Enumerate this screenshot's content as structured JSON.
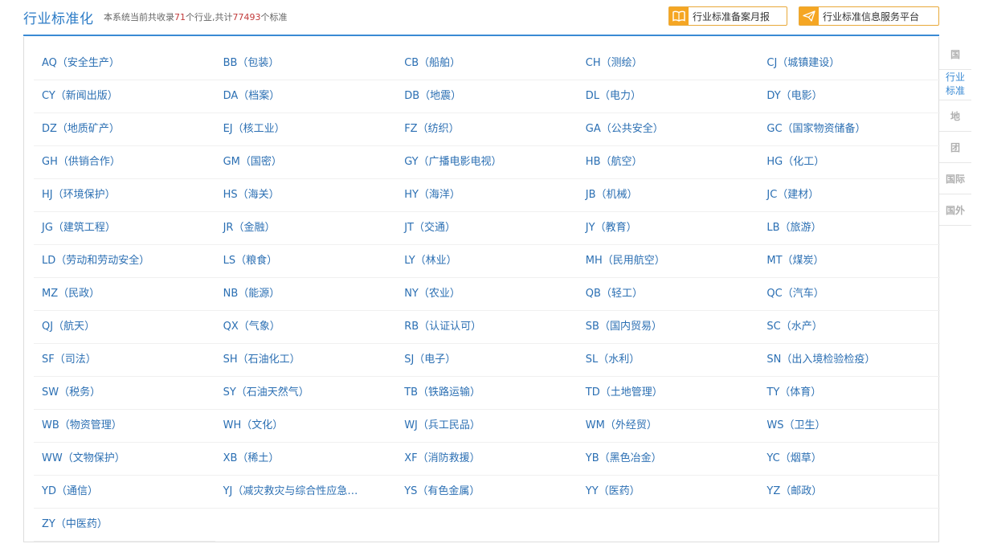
{
  "header": {
    "title": "行业标准化",
    "summary_prefix": "本系统当前共收录",
    "industry_count": "71",
    "summary_mid": "个行业,共计",
    "standard_count": "77493",
    "summary_suffix": "个标准",
    "btn_monthly_report": "行业标准备案月报",
    "btn_info_platform": "行业标准信息服务平台"
  },
  "industries": [
    "AQ（安全生产）",
    "BB（包装）",
    "CB（船舶）",
    "CH（测绘）",
    "CJ（城镇建设）",
    "CY（新闻出版）",
    "DA（档案）",
    "DB（地震）",
    "DL（电力）",
    "DY（电影）",
    "DZ（地质矿产）",
    "EJ（核工业）",
    "FZ（纺织）",
    "GA（公共安全）",
    "GC（国家物资储备）",
    "GH（供销合作）",
    "GM（国密）",
    "GY（广播电影电视）",
    "HB（航空）",
    "HG（化工）",
    "HJ（环境保护）",
    "HS（海关）",
    "HY（海洋）",
    "JB（机械）",
    "JC（建材）",
    "JG（建筑工程）",
    "JR（金融）",
    "JT（交通）",
    "JY（教育）",
    "LB（旅游）",
    "LD（劳动和劳动安全）",
    "LS（粮食）",
    "LY（林业）",
    "MH（民用航空）",
    "MT（煤炭）",
    "MZ（民政）",
    "NB（能源）",
    "NY（农业）",
    "QB（轻工）",
    "QC（汽车）",
    "QJ（航天）",
    "QX（气象）",
    "RB（认证认可）",
    "SB（国内贸易）",
    "SC（水产）",
    "SF（司法）",
    "SH（石油化工）",
    "SJ（电子）",
    "SL（水利）",
    "SN（出入境检验检疫）",
    "SW（税务）",
    "SY（石油天然气）",
    "TB（铁路运输）",
    "TD（土地管理）",
    "TY（体育）",
    "WB（物资管理）",
    "WH（文化）",
    "WJ（兵工民品）",
    "WM（外经贸）",
    "WS（卫生）",
    "WW（文物保护）",
    "XB（稀土）",
    "XF（消防救援）",
    "YB（黑色冶金）",
    "YC（烟草）",
    "YD（通信）",
    "YJ（减灾救灾与综合性应急…",
    "YS（有色金属）",
    "YY（医药）",
    "YZ（邮政）",
    "ZY（中医药）"
  ],
  "sidenav": [
    {
      "label": "国",
      "active": false
    },
    {
      "label": "行业标准",
      "active": true
    },
    {
      "label": "地",
      "active": false
    },
    {
      "label": "团",
      "active": false
    },
    {
      "label": "国际",
      "active": false
    },
    {
      "label": "国外",
      "active": false
    }
  ],
  "colors": {
    "accent": "#2b7bc6",
    "highlight_number": "#c23b3b",
    "button_border": "#e8a93a",
    "button_icon_bg": "#f5a623"
  }
}
